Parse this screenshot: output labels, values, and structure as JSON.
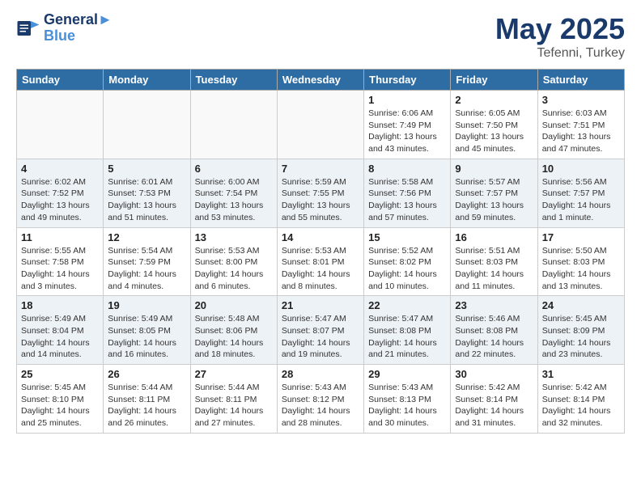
{
  "header": {
    "logo_line1": "General",
    "logo_line2": "Blue",
    "title": "May 2025",
    "subtitle": "Tefenni, Turkey"
  },
  "days_of_week": [
    "Sunday",
    "Monday",
    "Tuesday",
    "Wednesday",
    "Thursday",
    "Friday",
    "Saturday"
  ],
  "weeks": [
    [
      {
        "num": "",
        "info": ""
      },
      {
        "num": "",
        "info": ""
      },
      {
        "num": "",
        "info": ""
      },
      {
        "num": "",
        "info": ""
      },
      {
        "num": "1",
        "info": "Sunrise: 6:06 AM\nSunset: 7:49 PM\nDaylight: 13 hours\nand 43 minutes."
      },
      {
        "num": "2",
        "info": "Sunrise: 6:05 AM\nSunset: 7:50 PM\nDaylight: 13 hours\nand 45 minutes."
      },
      {
        "num": "3",
        "info": "Sunrise: 6:03 AM\nSunset: 7:51 PM\nDaylight: 13 hours\nand 47 minutes."
      }
    ],
    [
      {
        "num": "4",
        "info": "Sunrise: 6:02 AM\nSunset: 7:52 PM\nDaylight: 13 hours\nand 49 minutes."
      },
      {
        "num": "5",
        "info": "Sunrise: 6:01 AM\nSunset: 7:53 PM\nDaylight: 13 hours\nand 51 minutes."
      },
      {
        "num": "6",
        "info": "Sunrise: 6:00 AM\nSunset: 7:54 PM\nDaylight: 13 hours\nand 53 minutes."
      },
      {
        "num": "7",
        "info": "Sunrise: 5:59 AM\nSunset: 7:55 PM\nDaylight: 13 hours\nand 55 minutes."
      },
      {
        "num": "8",
        "info": "Sunrise: 5:58 AM\nSunset: 7:56 PM\nDaylight: 13 hours\nand 57 minutes."
      },
      {
        "num": "9",
        "info": "Sunrise: 5:57 AM\nSunset: 7:57 PM\nDaylight: 13 hours\nand 59 minutes."
      },
      {
        "num": "10",
        "info": "Sunrise: 5:56 AM\nSunset: 7:57 PM\nDaylight: 14 hours\nand 1 minute."
      }
    ],
    [
      {
        "num": "11",
        "info": "Sunrise: 5:55 AM\nSunset: 7:58 PM\nDaylight: 14 hours\nand 3 minutes."
      },
      {
        "num": "12",
        "info": "Sunrise: 5:54 AM\nSunset: 7:59 PM\nDaylight: 14 hours\nand 4 minutes."
      },
      {
        "num": "13",
        "info": "Sunrise: 5:53 AM\nSunset: 8:00 PM\nDaylight: 14 hours\nand 6 minutes."
      },
      {
        "num": "14",
        "info": "Sunrise: 5:53 AM\nSunset: 8:01 PM\nDaylight: 14 hours\nand 8 minutes."
      },
      {
        "num": "15",
        "info": "Sunrise: 5:52 AM\nSunset: 8:02 PM\nDaylight: 14 hours\nand 10 minutes."
      },
      {
        "num": "16",
        "info": "Sunrise: 5:51 AM\nSunset: 8:03 PM\nDaylight: 14 hours\nand 11 minutes."
      },
      {
        "num": "17",
        "info": "Sunrise: 5:50 AM\nSunset: 8:03 PM\nDaylight: 14 hours\nand 13 minutes."
      }
    ],
    [
      {
        "num": "18",
        "info": "Sunrise: 5:49 AM\nSunset: 8:04 PM\nDaylight: 14 hours\nand 14 minutes."
      },
      {
        "num": "19",
        "info": "Sunrise: 5:49 AM\nSunset: 8:05 PM\nDaylight: 14 hours\nand 16 minutes."
      },
      {
        "num": "20",
        "info": "Sunrise: 5:48 AM\nSunset: 8:06 PM\nDaylight: 14 hours\nand 18 minutes."
      },
      {
        "num": "21",
        "info": "Sunrise: 5:47 AM\nSunset: 8:07 PM\nDaylight: 14 hours\nand 19 minutes."
      },
      {
        "num": "22",
        "info": "Sunrise: 5:47 AM\nSunset: 8:08 PM\nDaylight: 14 hours\nand 21 minutes."
      },
      {
        "num": "23",
        "info": "Sunrise: 5:46 AM\nSunset: 8:08 PM\nDaylight: 14 hours\nand 22 minutes."
      },
      {
        "num": "24",
        "info": "Sunrise: 5:45 AM\nSunset: 8:09 PM\nDaylight: 14 hours\nand 23 minutes."
      }
    ],
    [
      {
        "num": "25",
        "info": "Sunrise: 5:45 AM\nSunset: 8:10 PM\nDaylight: 14 hours\nand 25 minutes."
      },
      {
        "num": "26",
        "info": "Sunrise: 5:44 AM\nSunset: 8:11 PM\nDaylight: 14 hours\nand 26 minutes."
      },
      {
        "num": "27",
        "info": "Sunrise: 5:44 AM\nSunset: 8:11 PM\nDaylight: 14 hours\nand 27 minutes."
      },
      {
        "num": "28",
        "info": "Sunrise: 5:43 AM\nSunset: 8:12 PM\nDaylight: 14 hours\nand 28 minutes."
      },
      {
        "num": "29",
        "info": "Sunrise: 5:43 AM\nSunset: 8:13 PM\nDaylight: 14 hours\nand 30 minutes."
      },
      {
        "num": "30",
        "info": "Sunrise: 5:42 AM\nSunset: 8:14 PM\nDaylight: 14 hours\nand 31 minutes."
      },
      {
        "num": "31",
        "info": "Sunrise: 5:42 AM\nSunset: 8:14 PM\nDaylight: 14 hours\nand 32 minutes."
      }
    ]
  ]
}
